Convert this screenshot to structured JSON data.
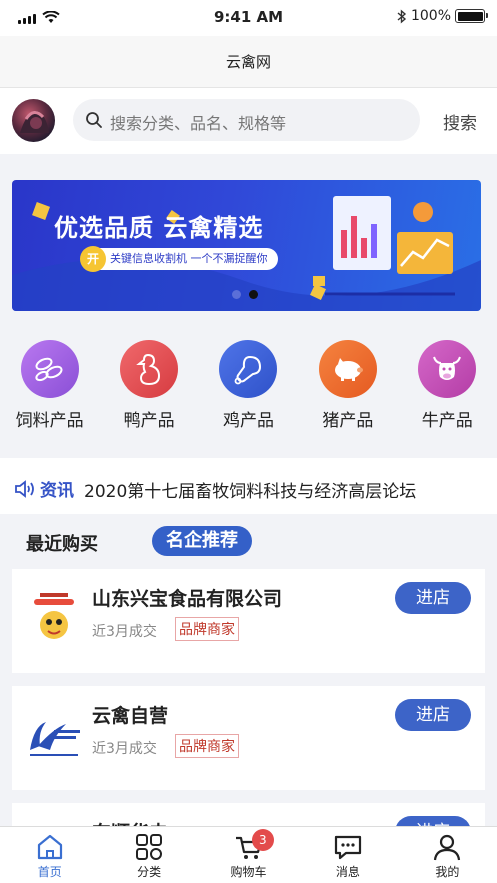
{
  "status_bar": {
    "time": "9:41 AM",
    "battery": "100%"
  },
  "nav": {
    "title": "云禽网"
  },
  "search": {
    "placeholder": "搜索分类、品名、规格等",
    "button": "搜索"
  },
  "banner": {
    "headline": "优选品质 云禽精选",
    "tagline": "关键信息收割机 一个不漏捉醒你",
    "badge": "开",
    "active_slide": 2,
    "slides": 2
  },
  "categories": [
    {
      "label": "饲料产品",
      "icon": "feed-icon",
      "color": "#a25fe0"
    },
    {
      "label": "鸭产品",
      "icon": "duck-icon",
      "color": "#e84a4f"
    },
    {
      "label": "鸡产品",
      "icon": "chicken-leg-icon",
      "color": "#3d63d9"
    },
    {
      "label": "猪产品",
      "icon": "pig-icon",
      "color": "#ef6a2f"
    },
    {
      "label": "牛产品",
      "icon": "cow-icon",
      "color": "#c64fb8"
    }
  ],
  "news": {
    "tag": "资讯",
    "headline": "2020第十七届畜牧饲料科技与经济高层论坛"
  },
  "tabs": {
    "recent": "最近购买",
    "recommended": "名企推荐"
  },
  "shops": [
    {
      "name": "山东兴宝食品有限公司",
      "deal": "近3月成交",
      "badge": "品牌商家",
      "button": "进店"
    },
    {
      "name": "云禽自营",
      "deal": "近3月成交",
      "badge": "品牌商家",
      "button": "进店"
    },
    {
      "name": "东顺华电",
      "deal": "",
      "badge": "",
      "button": "进店"
    }
  ],
  "tabbar": {
    "items": [
      {
        "label": "首页",
        "icon": "home-icon"
      },
      {
        "label": "分类",
        "icon": "grid-icon"
      },
      {
        "label": "购物车",
        "icon": "cart-icon"
      },
      {
        "label": "消息",
        "icon": "message-icon"
      },
      {
        "label": "我的",
        "icon": "user-icon"
      }
    ],
    "cart_badge": "3"
  }
}
